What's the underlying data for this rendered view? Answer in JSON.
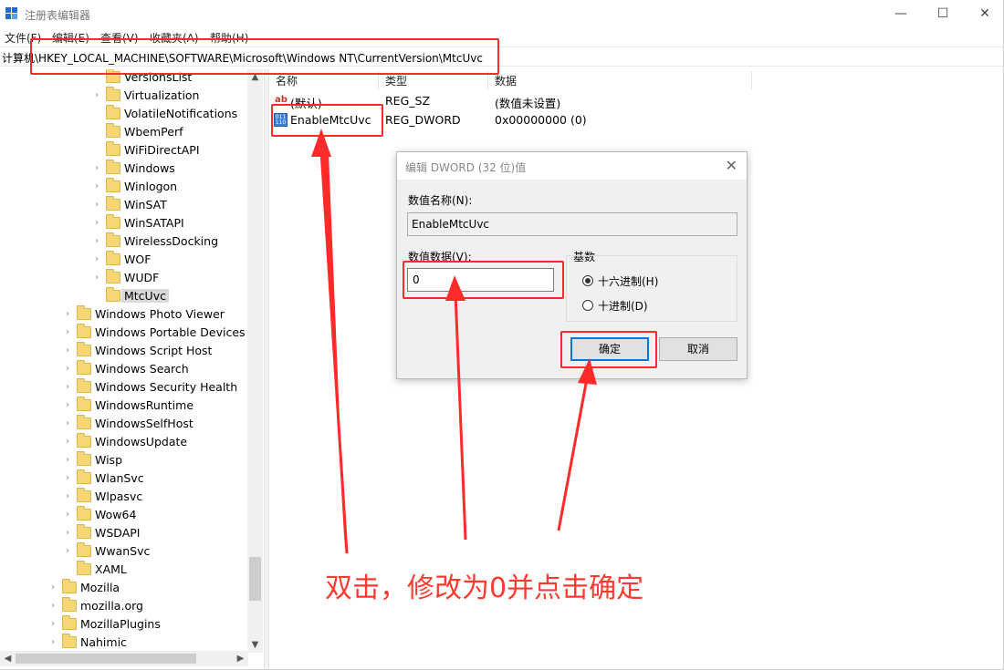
{
  "window": {
    "title": "注册表编辑器",
    "minimize": "—",
    "maximize": "☐",
    "close": "✕"
  },
  "menu": [
    "文件(F)",
    "编辑(E)",
    "查看(V)",
    "收藏夹(A)",
    "帮助(H)"
  ],
  "address": "计算机\\HKEY_LOCAL_MACHINE\\SOFTWARE\\Microsoft\\Windows NT\\CurrentVersion\\MtcUvc",
  "tree": {
    "nested_items": [
      {
        "label": "VersionsList",
        "expandable": false
      },
      {
        "label": "Virtualization",
        "expandable": true
      },
      {
        "label": "VolatileNotifications",
        "expandable": false
      },
      {
        "label": "WbemPerf",
        "expandable": false
      },
      {
        "label": "WiFiDirectAPI",
        "expandable": false
      },
      {
        "label": "Windows",
        "expandable": true
      },
      {
        "label": "Winlogon",
        "expandable": true
      },
      {
        "label": "WinSAT",
        "expandable": true
      },
      {
        "label": "WinSATAPI",
        "expandable": true
      },
      {
        "label": "WirelessDocking",
        "expandable": true
      },
      {
        "label": "WOF",
        "expandable": true
      },
      {
        "label": "WUDF",
        "expandable": true
      },
      {
        "label": "MtcUvc",
        "expandable": false,
        "selected": true
      }
    ],
    "windows_items": [
      {
        "label": "Windows Photo Viewer",
        "expandable": true
      },
      {
        "label": "Windows Portable Devices",
        "expandable": true
      },
      {
        "label": "Windows Script Host",
        "expandable": true
      },
      {
        "label": "Windows Search",
        "expandable": true
      },
      {
        "label": "Windows Security Health",
        "expandable": true
      },
      {
        "label": "WindowsRuntime",
        "expandable": true
      },
      {
        "label": "WindowsSelfHost",
        "expandable": true
      },
      {
        "label": "WindowsUpdate",
        "expandable": true
      },
      {
        "label": "Wisp",
        "expandable": true
      },
      {
        "label": "WlanSvc",
        "expandable": true
      },
      {
        "label": "Wlpasvc",
        "expandable": true
      },
      {
        "label": "Wow64",
        "expandable": true
      },
      {
        "label": "WSDAPI",
        "expandable": true
      },
      {
        "label": "WwanSvc",
        "expandable": true
      },
      {
        "label": "XAML",
        "expandable": false
      }
    ],
    "top_items": [
      {
        "label": "Mozilla",
        "expandable": true
      },
      {
        "label": "mozilla.org",
        "expandable": true
      },
      {
        "label": "MozillaPlugins",
        "expandable": true
      },
      {
        "label": "Nahimic",
        "expandable": true
      }
    ]
  },
  "list": {
    "columns": [
      "名称",
      "类型",
      "数据"
    ],
    "rows": [
      {
        "icon": "string-value-icon",
        "name": "(默认)",
        "type": "REG_SZ",
        "data": "(数值未设置)"
      },
      {
        "icon": "dword-value-icon",
        "name": "EnableMtcUvc",
        "type": "REG_DWORD",
        "data": "0x00000000 (0)"
      }
    ]
  },
  "dialog": {
    "title": "编辑 DWORD (32 位)值",
    "name_label": "数值名称(N):",
    "name_value": "EnableMtcUvc",
    "data_label": "数值数据(V):",
    "data_value": "0",
    "base_label": "基数",
    "radio_hex": "十六进制(H)",
    "radio_dec": "十进制(D)",
    "selected_base": "hex",
    "ok": "确定",
    "cancel": "取消"
  },
  "annotation": {
    "text": "双击，修改为0并点击确定",
    "color": "#ff3b30"
  },
  "colors": {
    "highlight_red": "#ff2a2a",
    "folder_yellow": "#f6d676",
    "accent_blue": "#0078d7"
  }
}
